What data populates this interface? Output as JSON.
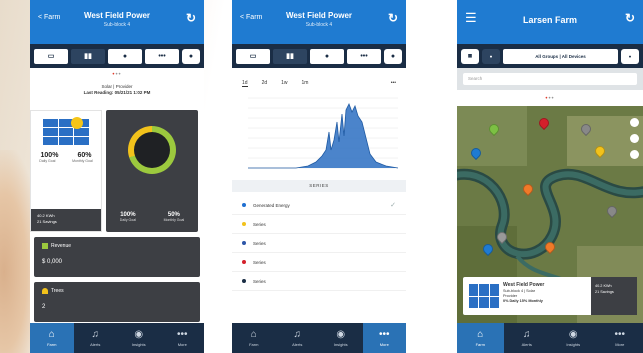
{
  "phone1": {
    "header": {
      "back": "< Farm",
      "title": "West Field Power",
      "subtitle": "Sub-block 4"
    },
    "tabs": [
      "",
      "",
      "",
      "•••",
      ""
    ],
    "meta": {
      "line1": "Solar | Provider",
      "line2": "Last Reading: 05/21/21 1:02 PM"
    },
    "solar": {
      "daily_value": "100%",
      "daily_label": "Daily Goal",
      "monthly_value": "60%",
      "monthly_label": "Monthly Goal",
      "foot_line1": "40.2 KWh",
      "foot_line2": "21 Savings"
    },
    "ring": {
      "daily_fraction": 0.7,
      "left_value": "100%",
      "left_label": "Daily Goal",
      "right_value": "50%",
      "right_label": "Monthly Goal"
    },
    "revenue": {
      "label": "Revenue",
      "value": "$ 0,000"
    },
    "trees": {
      "label": "Trees",
      "value": "2"
    }
  },
  "phone2": {
    "header": {
      "back": "< Farm",
      "title": "West Field Power",
      "subtitle": "Sub-block 4"
    },
    "periods": [
      "1d",
      "2d",
      "1w",
      "1m"
    ],
    "more": "•••",
    "series_header": "SERIES",
    "series": [
      {
        "name": "Generated Energy",
        "color": "#1f6fd1",
        "checked": true
      },
      {
        "name": "Series",
        "color": "#f2c21b",
        "checked": false
      },
      {
        "name": "Series",
        "color": "#2d56a8",
        "checked": false
      },
      {
        "name": "Series",
        "color": "#d4202b",
        "checked": false
      },
      {
        "name": "Series",
        "color": "#1a2d45",
        "checked": false
      }
    ]
  },
  "phone3": {
    "header": {
      "title": "Larsen Farm"
    },
    "tabs": {
      "filter_label": "All Groups | All Devices"
    },
    "search_placeholder": "Search",
    "farm_card": {
      "title": "West Field Power",
      "line1": "Sub-block 4 | Solar",
      "line2": "Provider",
      "stats": "0% Daily   15% Monthly",
      "side_line1": "40.2 KWh",
      "side_line2": "21 Savings"
    }
  },
  "navbar": [
    {
      "icon": "farm-icon",
      "glyph": "⌂",
      "label": "Farm"
    },
    {
      "icon": "alerts-icon",
      "glyph": "♫",
      "label": "Alerts"
    },
    {
      "icon": "insights-icon",
      "glyph": "◉",
      "label": "Insights"
    },
    {
      "icon": "more-icon",
      "glyph": "•••",
      "label": "More"
    }
  ],
  "colors": {
    "header_blue": "#1f7bd1",
    "dark_navy": "#1a2d45",
    "card_gray": "#3d3f44",
    "green": "#9cc93e",
    "yellow": "#f2c21b",
    "chart_blue": "#2c6fc2"
  }
}
